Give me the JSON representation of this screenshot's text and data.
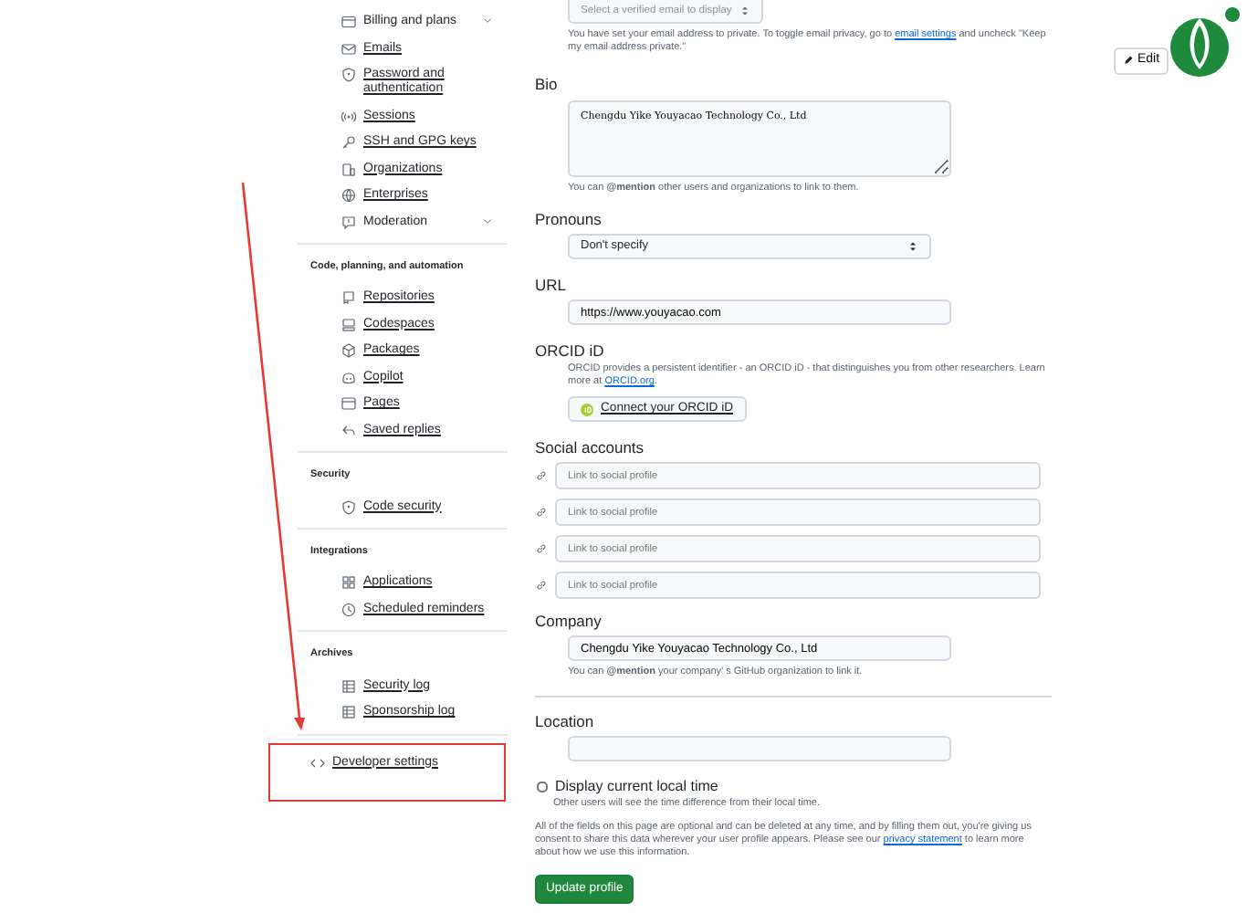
{
  "sidebar": {
    "groups": [
      {
        "items": [
          {
            "label": "Billing and plans",
            "kind": "collapsible"
          },
          {
            "label": "Emails",
            "kind": "link"
          },
          {
            "label": "Password and\nauthentication",
            "kind": "link"
          },
          {
            "label": "Sessions",
            "kind": "link"
          },
          {
            "label": "SSH and GPG keys",
            "kind": "link"
          },
          {
            "label": "Organizations",
            "kind": "link"
          },
          {
            "label": "Enterprises",
            "kind": "link"
          },
          {
            "label": "Moderation",
            "kind": "collapsible"
          }
        ]
      },
      {
        "heading": "Code, planning, and automation",
        "items": [
          {
            "label": "Repositories",
            "kind": "link"
          },
          {
            "label": "Codespaces",
            "kind": "link"
          },
          {
            "label": "Packages",
            "kind": "link"
          },
          {
            "label": "Copilot",
            "kind": "link"
          },
          {
            "label": "Pages",
            "kind": "link"
          },
          {
            "label": "Saved replies",
            "kind": "link"
          }
        ]
      },
      {
        "heading": "Security",
        "items": [
          {
            "label": "Code security",
            "kind": "link"
          }
        ]
      },
      {
        "heading": "Integrations",
        "items": [
          {
            "label": "Applications",
            "kind": "link"
          },
          {
            "label": "Scheduled reminders",
            "kind": "link"
          }
        ]
      },
      {
        "heading": "Archives",
        "items": [
          {
            "label": "Security log",
            "kind": "link"
          },
          {
            "label": "Sponsorship log",
            "kind": "link"
          }
        ]
      },
      {
        "items": [
          {
            "label": "Developer settings",
            "kind": "top-level"
          }
        ]
      }
    ]
  },
  "email": {
    "placeholder": "Select a verified email to display",
    "note_before": "You have set your email address to private. To toggle email privacy, go to",
    "note_link": "email settings",
    "note_after": "and uncheck \"Keep my email address private.\""
  },
  "bio": {
    "label": "Bio",
    "value": "Chengdu Yike Youyacao Technology Co., Ltd",
    "note": "You can **@mention** other users and organizations to link to them."
  },
  "pronouns": {
    "label": "Pronouns",
    "value": "Don't specify"
  },
  "url": {
    "label": "URL",
    "value": "https://www.youyacao.com"
  },
  "orcid": {
    "label": "ORCID iD",
    "note_before": "ORCID provides a persistent identifier - an ORCID iD - that distinguishes you from other researchers. Learn more at",
    "note_link": "ORCID.org",
    "note_after": ".",
    "button": "Connect your ORCID iD"
  },
  "social": {
    "label": "Social accounts",
    "fields": [
      {
        "placeholder": "Link to social profile"
      },
      {
        "placeholder": "Link to social profile"
      },
      {
        "placeholder": "Link to social profile"
      },
      {
        "placeholder": "Link to social profile"
      }
    ]
  },
  "company": {
    "label": "Company",
    "value": "Chengdu Yike Youyacao Technology Co., Ltd",
    "note": "You can **@mention** your company’ s GitHub organization to link it."
  },
  "location": {
    "label": "Location"
  },
  "local_time": {
    "label": "Display current local time",
    "checked": false,
    "note": "Other users will see the time difference from their local time."
  },
  "footer": {
    "before": "All of the fields on this page are optional and can be deleted at any time, and by filling them out, you're giving us consent to share this data wherever your user profile appears. Please see our",
    "link": "privacy statement",
    "after": "to learn more about how we use this information."
  },
  "submit": "Update profile",
  "avatar": {
    "edit": "Edit"
  }
}
